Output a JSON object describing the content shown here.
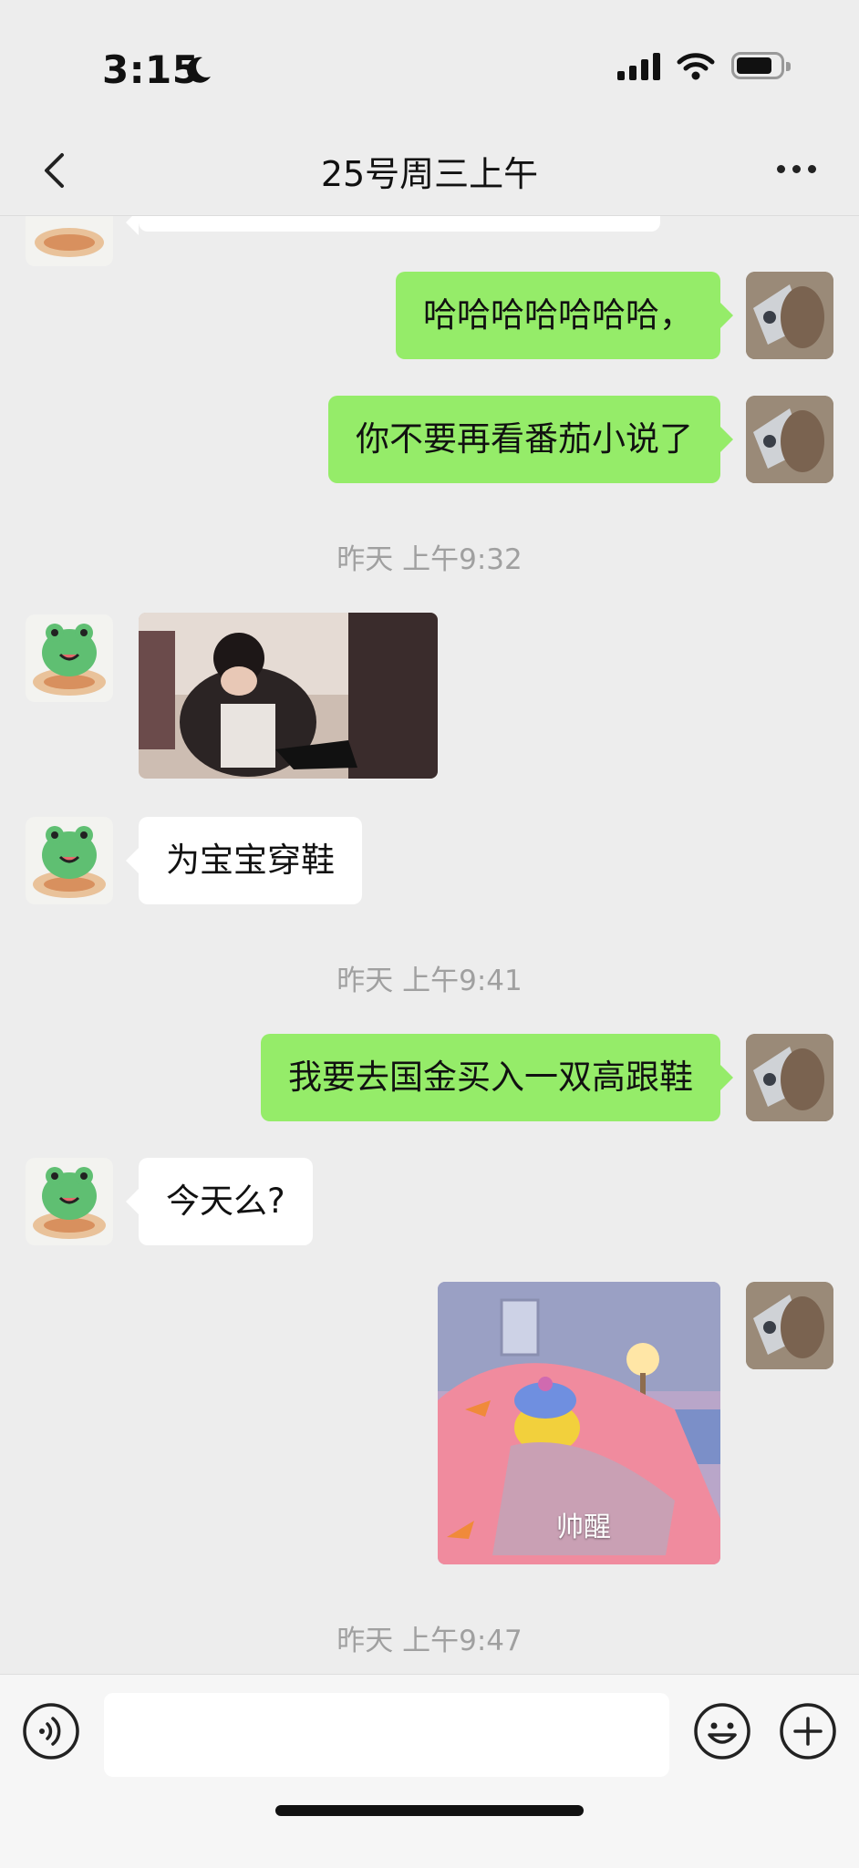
{
  "status_bar": {
    "time": "3:15"
  },
  "nav": {
    "title": "25号周三上午"
  },
  "messages": {
    "m1": "哈哈哈哈哈哈哈，",
    "m2": "你不要再看番茄小说了",
    "ts1": "昨天 上午9:32",
    "m3": "为宝宝穿鞋",
    "ts2": "昨天 上午9:41",
    "m4": "我要去国金买入一双高跟鞋",
    "m5": "今天么?",
    "sticker_caption": "帅醒",
    "ts3": "昨天 上午9:47"
  },
  "input": {
    "placeholder": ""
  },
  "colors": {
    "sent_bubble": "#95ec69",
    "received_bubble": "#ffffff",
    "background": "#ededed"
  }
}
